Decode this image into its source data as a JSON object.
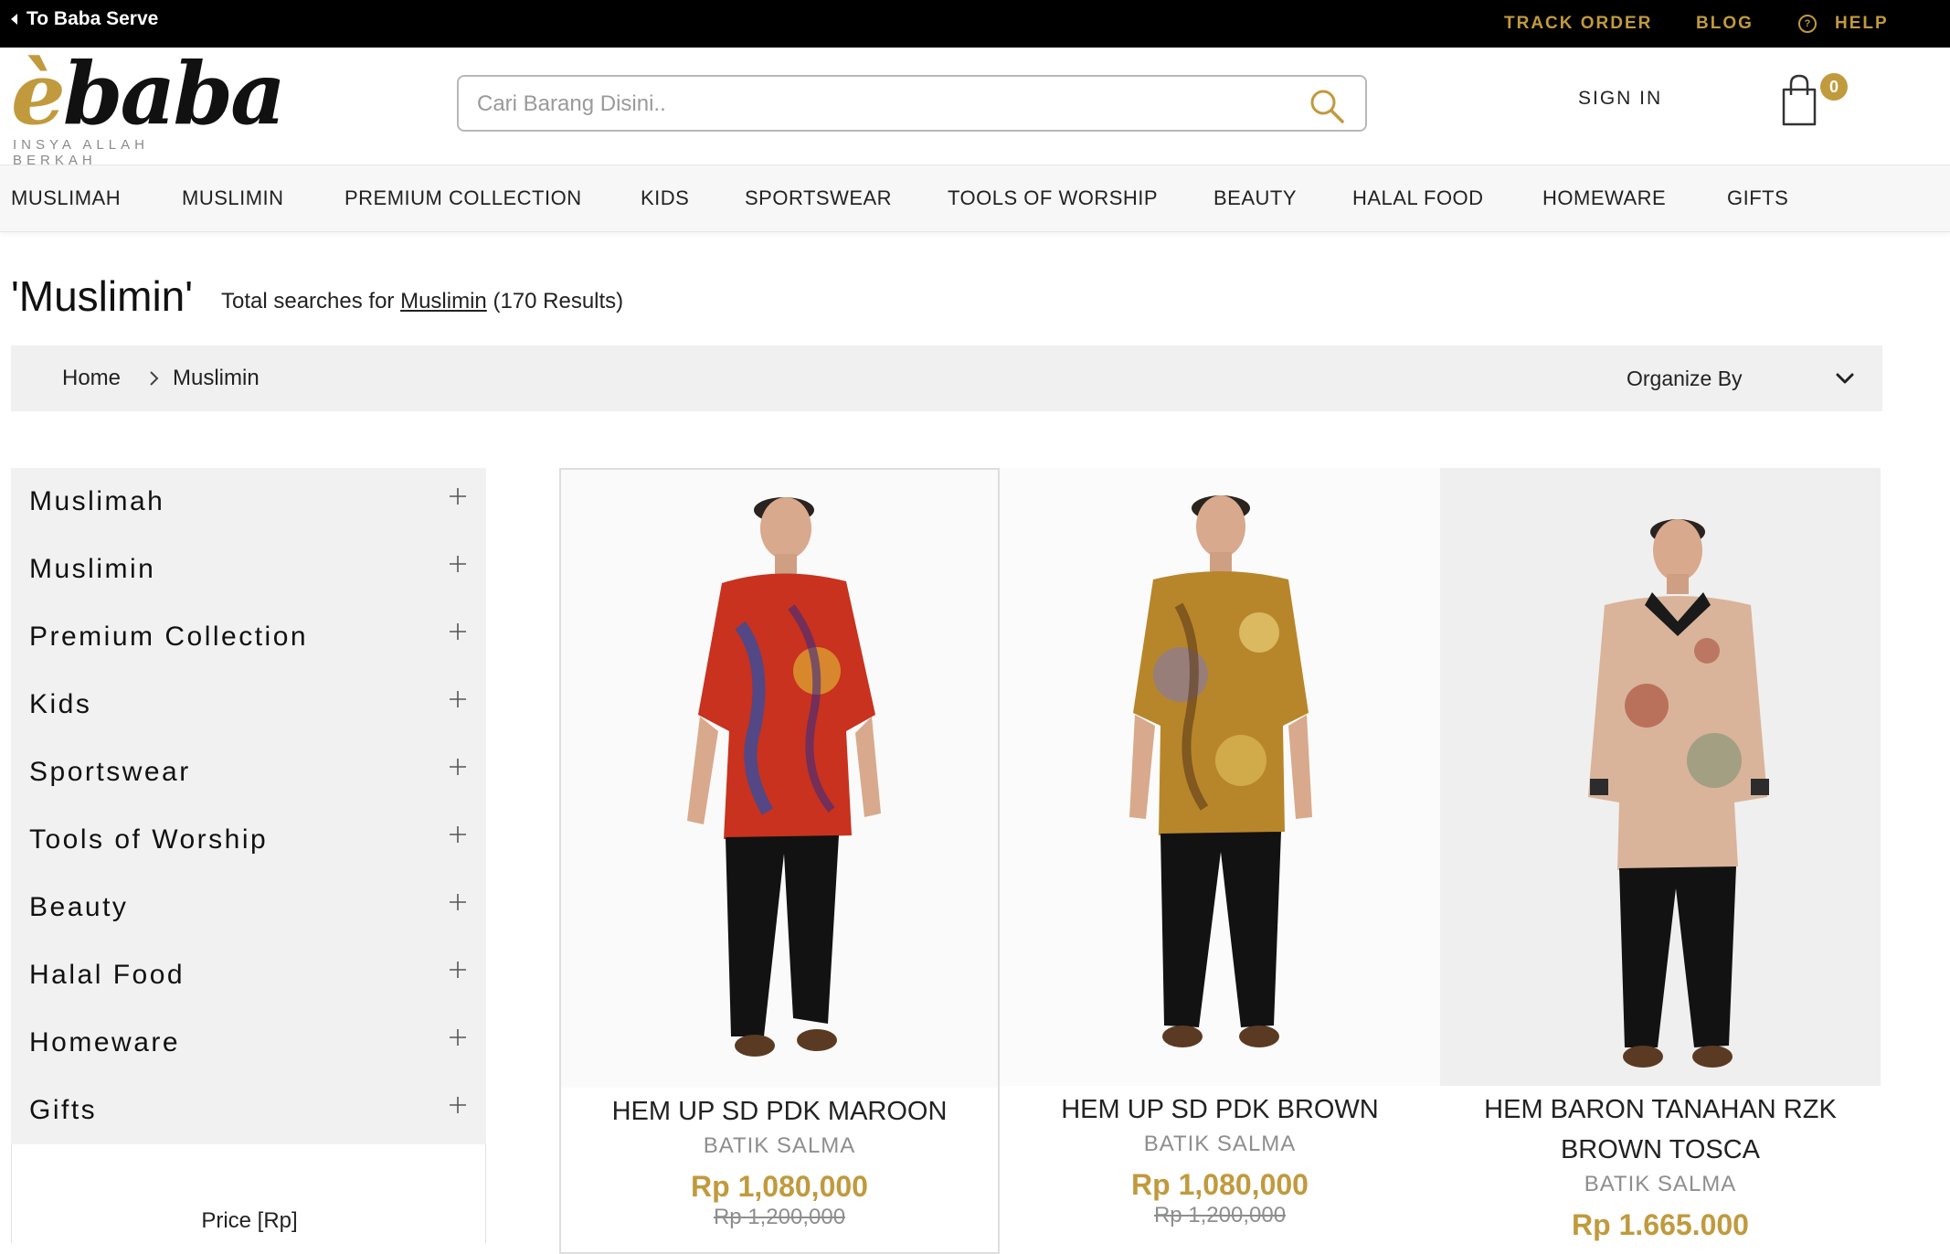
{
  "topbar": {
    "back_label": "To Baba Serve",
    "links": {
      "track_order": "TRACK ORDER",
      "blog": "BLOG",
      "help": "HELP"
    },
    "help_glyph": "?"
  },
  "header": {
    "logo": {
      "wordmark_e": "è",
      "wordmark_rest": "baba",
      "tagline": "INSYA ALLAH BERKAH"
    },
    "search": {
      "placeholder": "Cari Barang Disini.."
    },
    "sign_in": "SIGN IN",
    "cart_count": "0"
  },
  "nav": {
    "items": [
      "MUSLIMAH",
      "MUSLIMIN",
      "PREMIUM COLLECTION",
      "KIDS",
      "SPORTSWEAR",
      "TOOLS OF WORSHIP",
      "BEAUTY",
      "HALAL FOOD",
      "HOMEWARE",
      "GIFTS"
    ]
  },
  "results": {
    "query_title": "'Muslimin'",
    "info_prefix": "Total searches for ",
    "info_link": "Muslimin",
    "info_suffix": " (170 Results)"
  },
  "breadcrumb": {
    "home": "Home",
    "current": "Muslimin"
  },
  "sort": {
    "label": "Organize By"
  },
  "sidebar": {
    "categories": [
      "Muslimah",
      "Muslimin",
      "Premium Collection",
      "Kids",
      "Sportswear",
      "Tools of Worship",
      "Beauty",
      "Halal Food",
      "Homeware",
      "Gifts"
    ],
    "price_label": "Price [Rp]"
  },
  "products": [
    {
      "name": "HEM UP SD PDK MAROON",
      "brand": "BATIK SALMA",
      "price": "Rp 1,080,000",
      "old_price": "Rp 1,200,000"
    },
    {
      "name": "HEM UP SD PDK BROWN",
      "brand": "BATIK SALMA",
      "price": "Rp 1,080,000",
      "old_price": "Rp 1,200,000"
    },
    {
      "name_line1": "HEM BARON TANAHAN RZK",
      "name_line2": "BROWN TOSCA",
      "brand": "BATIK SALMA",
      "price": "Rp 1.665.000"
    }
  ],
  "colors": {
    "accent_gold": "#c19a3e",
    "topbar_bg": "#000000",
    "sidebar_bg": "#f1f1f1"
  },
  "icons": [
    "back-caret-icon",
    "help-circle-icon",
    "search-icon",
    "shopping-bag-icon",
    "chevron-right-icon",
    "chevron-down-icon",
    "plus-icon"
  ]
}
